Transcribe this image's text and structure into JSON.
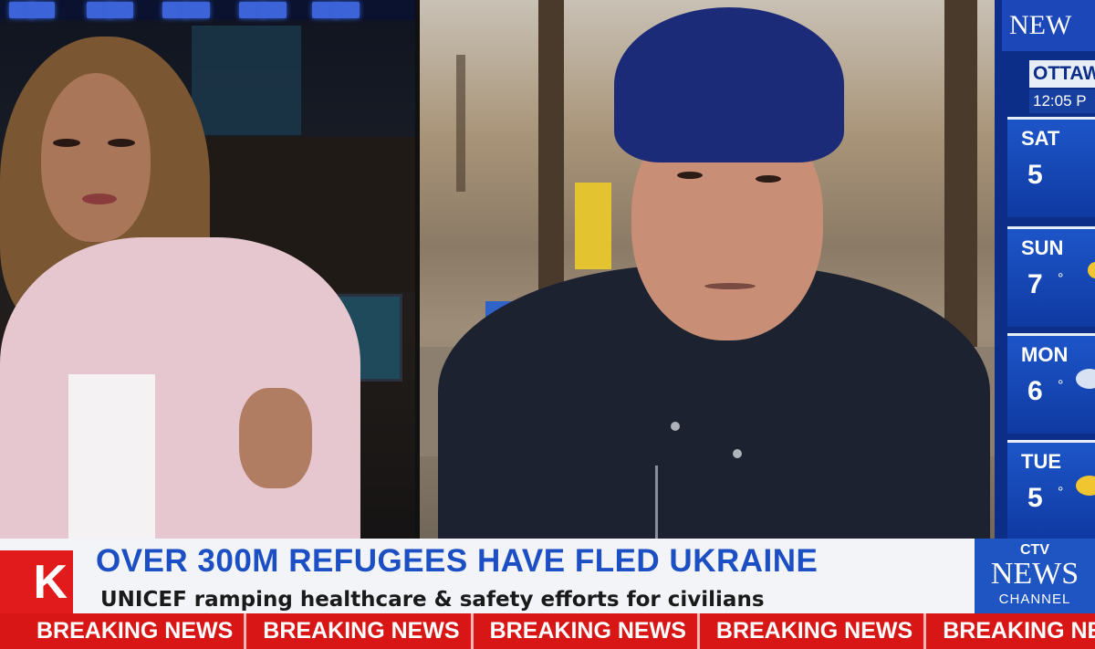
{
  "weather": {
    "logo": "NEW",
    "city": "OTTAW",
    "time": "12:05 P",
    "days": [
      {
        "day": "SAT",
        "temp": "5",
        "deg": ""
      },
      {
        "day": "SUN",
        "temp": "7",
        "deg": "°"
      },
      {
        "day": "MON",
        "temp": "6",
        "deg": "°"
      },
      {
        "day": "TUE",
        "temp": "5",
        "deg": "°"
      }
    ]
  },
  "lower_third": {
    "bug": "K",
    "headline": "OVER 300M REFUGEES HAVE FLED UKRAINE",
    "subline": "UNICEF ramping healthcare & safety efforts for civilians"
  },
  "network": {
    "ctv": "CTV",
    "news": "NEWS",
    "channel": "CHANNEL"
  },
  "ticker": {
    "items": [
      "BREAKING NEWS",
      "BREAKING NEWS",
      "BREAKING NEWS",
      "BREAKING NEWS",
      "BREAKING NE"
    ]
  },
  "colors": {
    "headline_blue": "#1c4fc4",
    "ticker_red": "#d81616",
    "weather_blue": "#0c2d88"
  }
}
